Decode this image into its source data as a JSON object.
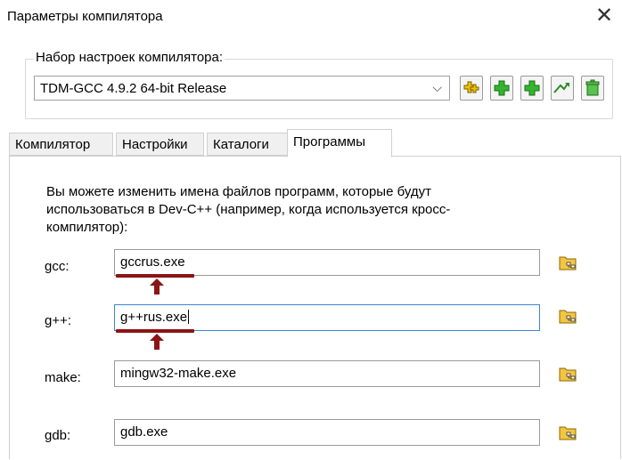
{
  "window": {
    "title": "Параметры компилятора",
    "close_icon": "close-icon"
  },
  "profile_group": {
    "label": "Набор настроек компилятора:",
    "selected": "TDM-GCC 4.9.2 64-bit Release",
    "buttons": [
      "add-profile-icon",
      "add-icon",
      "add-icon",
      "rename-icon",
      "delete-icon"
    ]
  },
  "tabs": [
    {
      "label": "Компилятор",
      "active": false
    },
    {
      "label": "Настройки",
      "active": false
    },
    {
      "label": "Каталоги",
      "active": false
    },
    {
      "label": "Программы",
      "active": true
    }
  ],
  "programs": {
    "description": "Вы можете изменить имена файлов программ, которые будут использоваться в Dev-C++ (например, когда используется кросс-компилятор):",
    "rows": [
      {
        "label": "gcc:",
        "value": "gccrus.exe"
      },
      {
        "label": "g++:",
        "value": "g++rus.exe"
      },
      {
        "label": "make:",
        "value": "mingw32-make.exe"
      },
      {
        "label": "gdb:",
        "value": "gdb.exe"
      }
    ]
  },
  "colors": {
    "annotation": "#8b1414",
    "focus_border": "#3b87d4"
  }
}
